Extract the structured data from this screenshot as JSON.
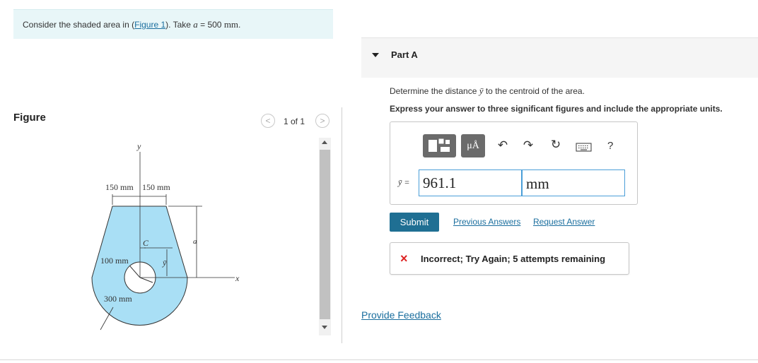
{
  "problem": {
    "prefix": "Consider the shaded area in (",
    "figure_link": "Figure 1",
    "suffix": "). Take ",
    "var": "a",
    "eq": " = 500 ",
    "unit": "mm",
    "end": "."
  },
  "figure": {
    "label": "Figure",
    "pager": "1 of 1",
    "prev_icon": "chevron-left-icon",
    "next_icon": "chevron-right-icon",
    "labels": {
      "y_axis": "y",
      "x_axis": "x",
      "dim_left": "150 mm",
      "dim_right": "150 mm",
      "centroid": "C",
      "height": "a",
      "ybar": "ȳ",
      "hole_radius": "100 mm",
      "outer_radius": "300 mm"
    },
    "shape_color": "#a9dff5"
  },
  "part_a": {
    "title": "Part A",
    "question": "Determine the distance ",
    "question_var": "ȳ",
    "question_end": " to the centroid of the area.",
    "instruction": "Express your answer to three significant figures and include the appropriate units.",
    "toolbar": {
      "templates_icon": "templates-icon",
      "units_label": "μÅ",
      "undo_icon": "undo-icon",
      "redo_icon": "redo-icon",
      "reset_icon": "reset-icon",
      "keyboard_icon": "keyboard-icon",
      "help_label": "?"
    },
    "answer_label": "ȳ =",
    "answer_value": "961.1",
    "answer_unit": "mm",
    "submit_label": "Submit",
    "previous_answers": "Previous Answers",
    "request_answer": "Request Answer",
    "feedback": "Incorrect; Try Again; 5 attempts remaining",
    "feedback_icon": "×"
  },
  "provide_feedback": "Provide Feedback",
  "colors": {
    "accent": "#1f6f93",
    "link": "#1a6e9e",
    "error": "#dd2222"
  }
}
